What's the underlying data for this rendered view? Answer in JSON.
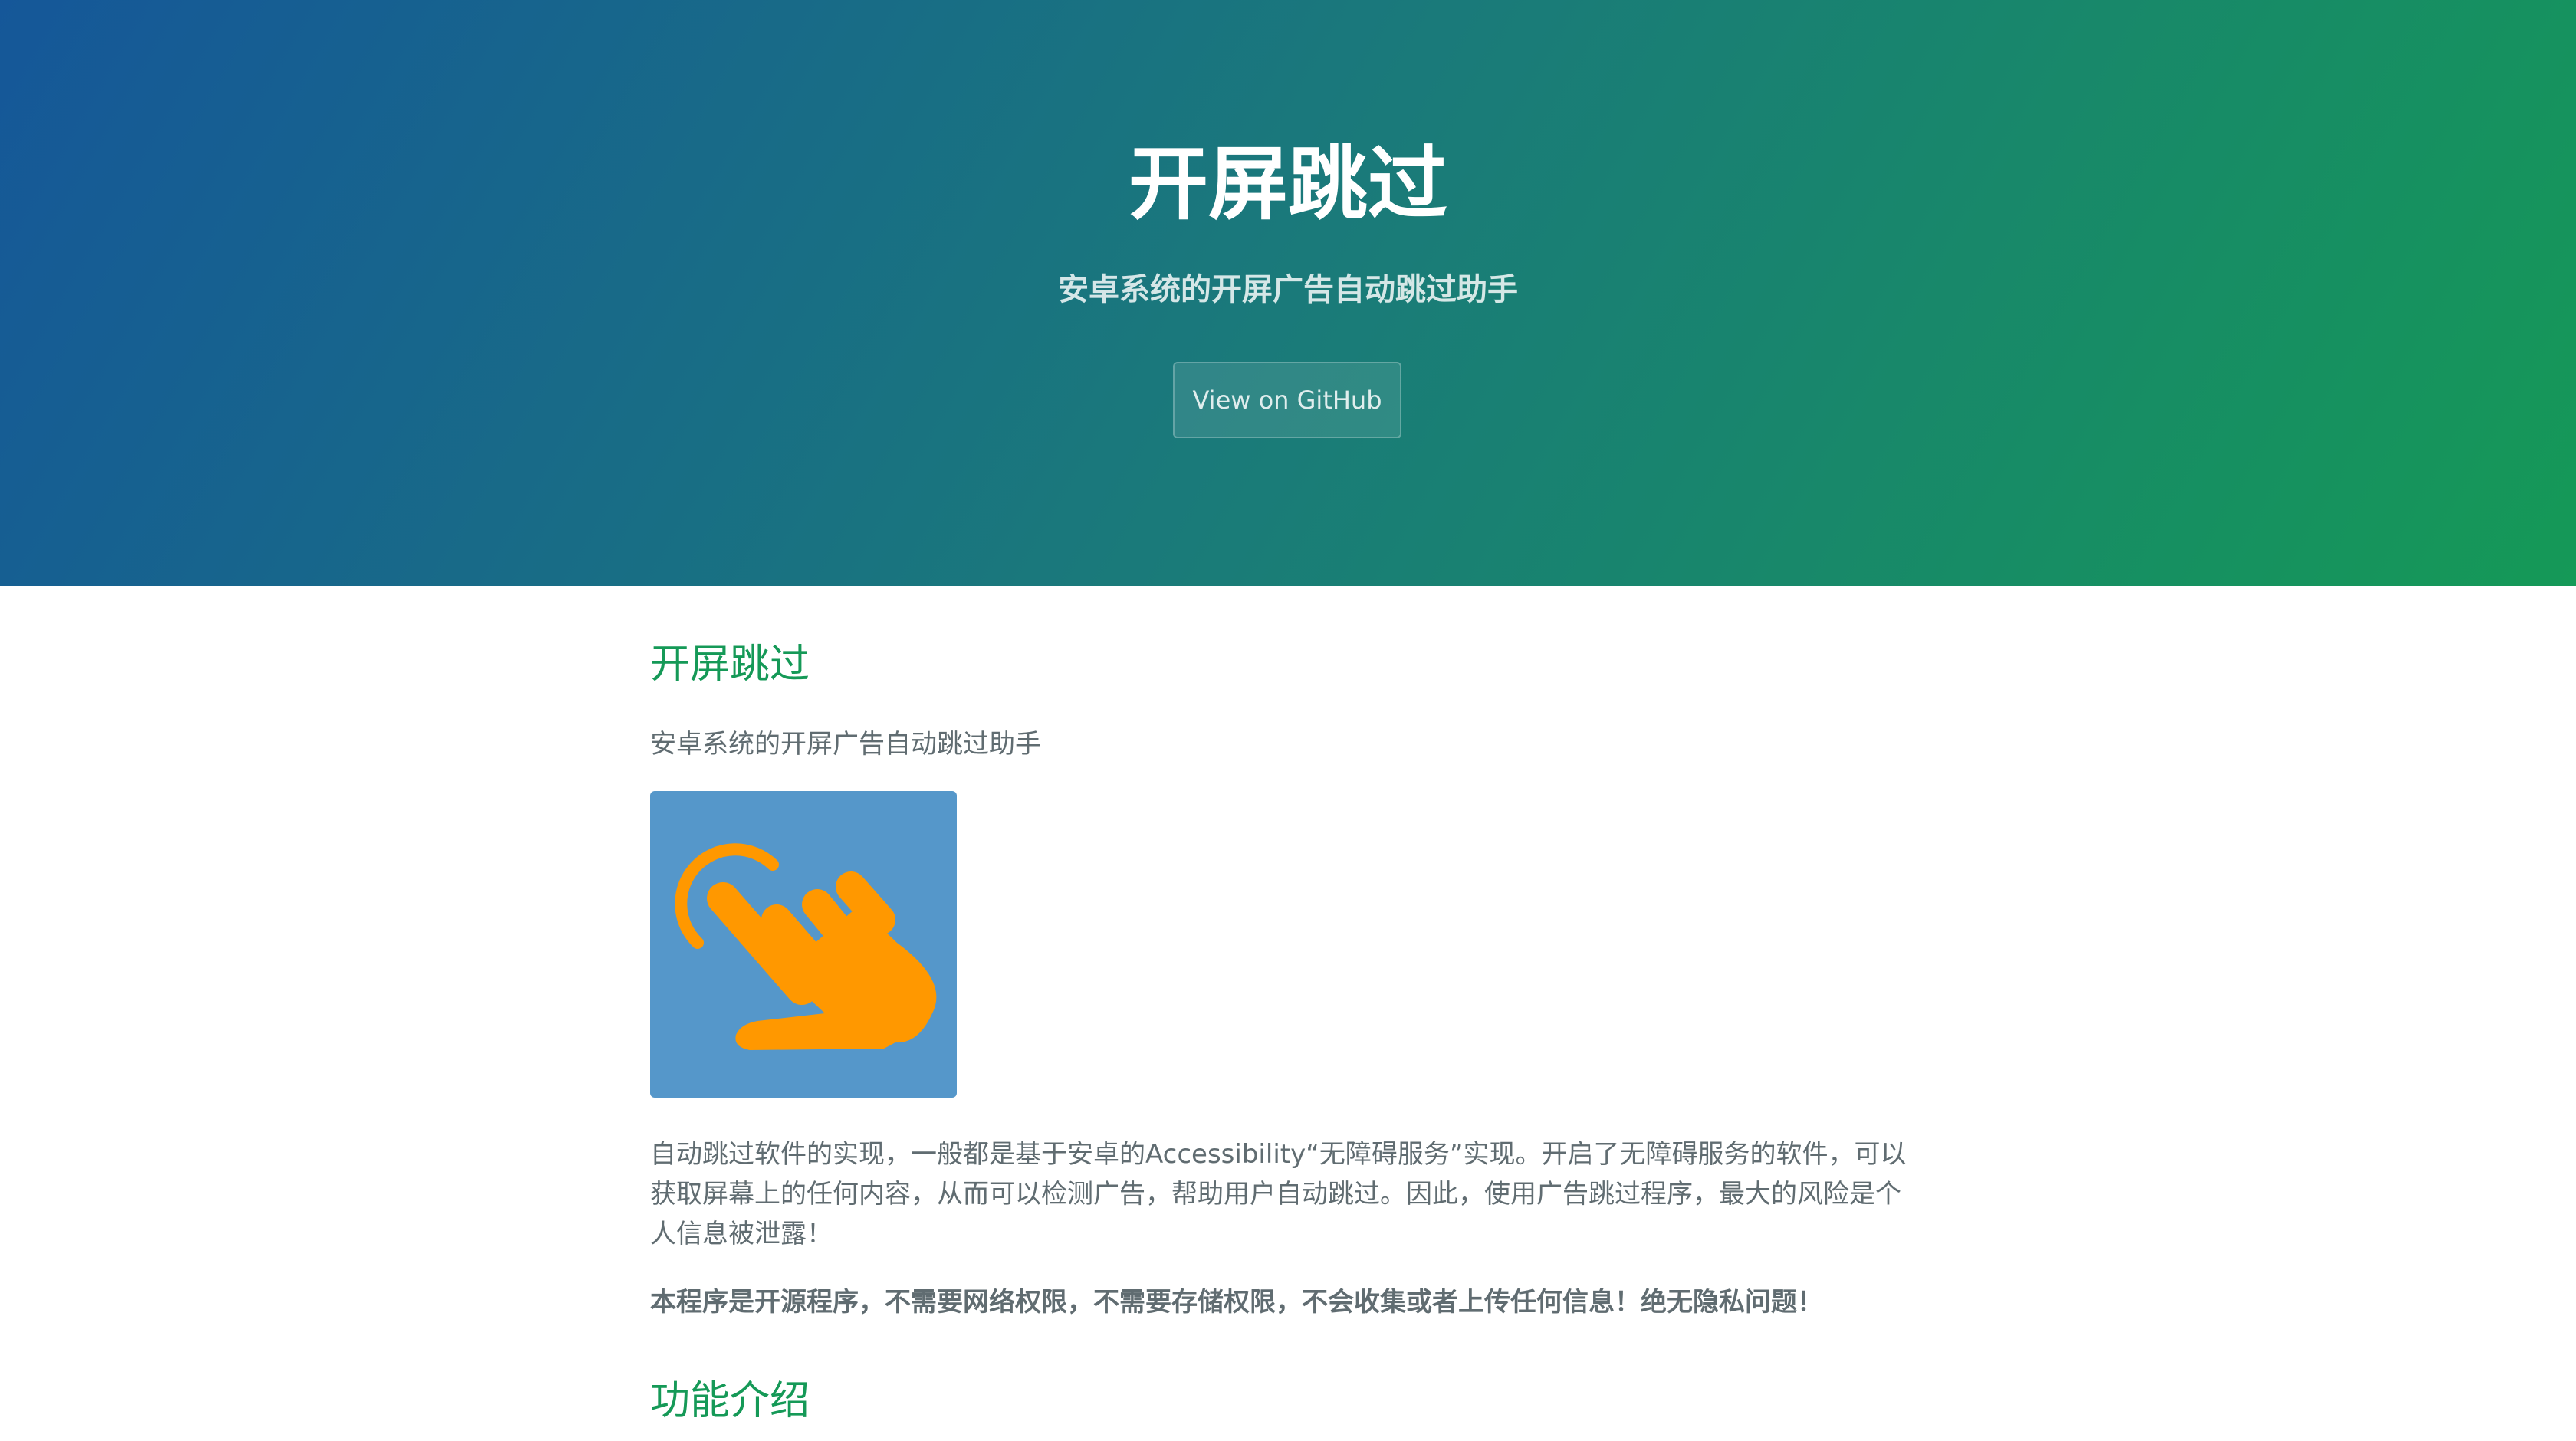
{
  "hero": {
    "title": "开屏跳过",
    "tagline": "安卓系统的开屏广告自动跳过助手",
    "button_label": "View on GitHub"
  },
  "main": {
    "heading_intro": "开屏跳过",
    "intro_text": "安卓系统的开屏广告自动跳过助手",
    "logo_icon": "tap-hand-icon",
    "colors": {
      "hero_gradient_start": "#155799",
      "hero_gradient_end": "#159957",
      "heading_color": "#159957",
      "logo_background": "#5597ca",
      "logo_hand": "#ff9800"
    },
    "description": "自动跳过软件的实现，一般都是基于安卓的Accessibility“无障碍服务”实现。开启了无障碍服务的软件，可以获取屏幕上的任何内容，从而可以检测广告，帮助用户自动跳过。因此，使用广告跳过程序，最大的风险是个人信息被泄露！",
    "privacy_note": "本程序是开源程序，不需要网络权限，不需要存储权限，不会收集或者上传任何信息！绝无隐私问题！",
    "heading_features": "功能介绍"
  }
}
